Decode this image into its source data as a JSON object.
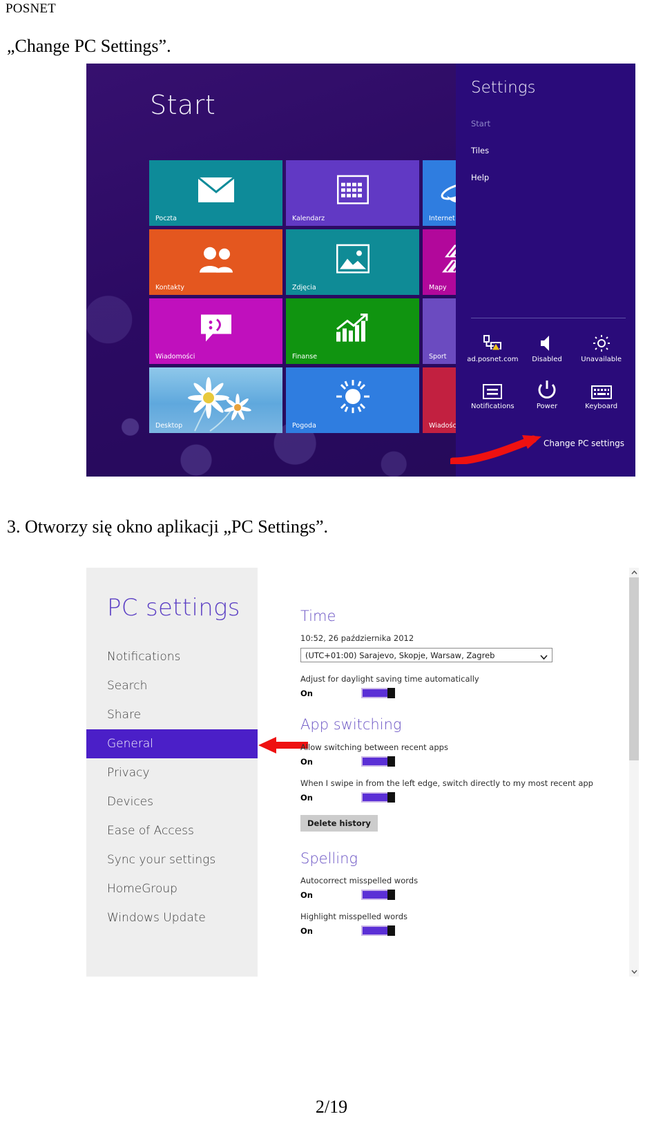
{
  "document": {
    "header": "POSNET",
    "intro_line": "„Change PC Settings”.",
    "step_line": "3. Otworzy się okno aplikacji „PC Settings”.",
    "footer": "2/19"
  },
  "start_screen": {
    "title": "Start",
    "background_color": "#2a0a63",
    "tiles": [
      {
        "label": "Poczta",
        "color": "#0e8b99",
        "icon": "mail-icon"
      },
      {
        "label": "Kalendarz",
        "color": "#6139c4",
        "icon": "calendar-icon"
      },
      {
        "label": "Internet",
        "color": "#2f7de0",
        "icon": "internet-explorer-icon"
      },
      {
        "label": "Kontakty",
        "color": "#e4571f",
        "icon": "people-icon"
      },
      {
        "label": "Zdjęcia",
        "color": "#0f8b96",
        "icon": "photos-icon"
      },
      {
        "label": "Mapy",
        "color": "#b2089b",
        "icon": "maps-icon"
      },
      {
        "label": "Wiadomości",
        "color": "#c010bd",
        "icon": "messaging-icon"
      },
      {
        "label": "Finanse",
        "color": "#109410",
        "icon": "finance-chart-icon"
      },
      {
        "label": "Sport",
        "color": "#6b4bc0",
        "icon": "sports-icon"
      },
      {
        "label": "Desktop",
        "color": "#6fb4e0",
        "icon": "desktop-flowers-icon"
      },
      {
        "label": "Pogoda",
        "color": "#2f7de0",
        "icon": "weather-sun-icon"
      },
      {
        "label": "Wiadości",
        "color": "#c22040",
        "icon": "news-icon"
      }
    ]
  },
  "charm": {
    "title": "Settings",
    "links": [
      {
        "label": "Start",
        "dimmed": true
      },
      {
        "label": "Tiles",
        "dimmed": false
      },
      {
        "label": "Help",
        "dimmed": false
      }
    ],
    "icons": [
      {
        "label": "ad.posnet.com",
        "icon": "network-warning-icon"
      },
      {
        "label": "Disabled",
        "icon": "volume-icon"
      },
      {
        "label": "Unavailable",
        "icon": "brightness-icon"
      },
      {
        "label": "Notifications",
        "icon": "notifications-icon"
      },
      {
        "label": "Power",
        "icon": "power-icon"
      },
      {
        "label": "Keyboard",
        "icon": "keyboard-icon"
      }
    ],
    "change_pc_settings": "Change PC settings",
    "arrow_color": "#ee1111"
  },
  "pc_settings": {
    "heading": "PC settings",
    "accent_color": "#5b3fc4",
    "selected_color": "#4b1fc8",
    "nav": [
      {
        "label": "Notifications",
        "selected": false
      },
      {
        "label": "Search",
        "selected": false
      },
      {
        "label": "Share",
        "selected": false
      },
      {
        "label": "General",
        "selected": true
      },
      {
        "label": "Privacy",
        "selected": false
      },
      {
        "label": "Devices",
        "selected": false
      },
      {
        "label": "Ease of Access",
        "selected": false
      },
      {
        "label": "Sync your settings",
        "selected": false
      },
      {
        "label": "HomeGroup",
        "selected": false
      },
      {
        "label": "Windows Update",
        "selected": false
      }
    ],
    "sections": {
      "time": {
        "title": "Time",
        "clock": "10:52, 26 października 2012",
        "timezone_selected": "(UTC+01:00) Sarajevo, Skopje, Warsaw, Zagreb",
        "dst_label": "Adjust for daylight saving time automatically",
        "dst_state": "On"
      },
      "app_switching": {
        "title": "App switching",
        "allow_label": "Allow switching between recent apps",
        "allow_state": "On",
        "swipe_label": "When I swipe in from the left edge, switch directly to my most recent app",
        "swipe_state": "On",
        "delete_history_button": "Delete history"
      },
      "spelling": {
        "title": "Spelling",
        "autocorrect_label": "Autocorrect misspelled words",
        "autocorrect_state": "On",
        "highlight_label": "Highlight misspelled words",
        "highlight_state": "On"
      }
    },
    "scrollbar": {
      "up_icon": "chevron-up-icon",
      "down_icon": "chevron-down-icon"
    }
  }
}
